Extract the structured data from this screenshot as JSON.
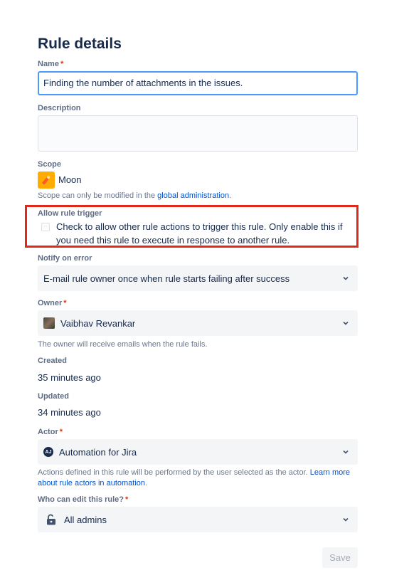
{
  "title": "Rule details",
  "name": {
    "label": "Name",
    "required_mark": "*",
    "value": "Finding the number of attachments in the issues."
  },
  "description": {
    "label": "Description",
    "value": ""
  },
  "scope": {
    "label": "Scope",
    "value": "Moon",
    "help_prefix": "Scope can only be modified in the ",
    "help_link": "global administration",
    "help_suffix": "."
  },
  "allow_trigger": {
    "label": "Allow rule trigger",
    "checked": false,
    "text": "Check to allow other rule actions to trigger this rule. Only enable this if you need this rule to execute in response to another rule."
  },
  "notify": {
    "label": "Notify on error",
    "value": "E-mail rule owner once when rule starts failing after success"
  },
  "owner": {
    "label": "Owner",
    "required_mark": "*",
    "value": "Vaibhav Revankar",
    "help": "The owner will receive emails when the rule fails."
  },
  "created": {
    "label": "Created",
    "value": "35 minutes ago"
  },
  "updated": {
    "label": "Updated",
    "value": "34 minutes ago"
  },
  "actor": {
    "label": "Actor",
    "required_mark": "*",
    "avatar_text": "AJ",
    "value": "Automation for Jira",
    "help": "Actions defined in this rule will be performed by the user selected as the actor. ",
    "help_link": "Learn more about rule actors in automation",
    "help_suffix": "."
  },
  "editors": {
    "label": "Who can edit this rule?",
    "required_mark": "*",
    "value": "All admins"
  },
  "save_label": "Save",
  "colors": {
    "required": "#de350b",
    "highlight": "#e0291a",
    "link": "#0052cc",
    "focus": "#4c9aff"
  }
}
